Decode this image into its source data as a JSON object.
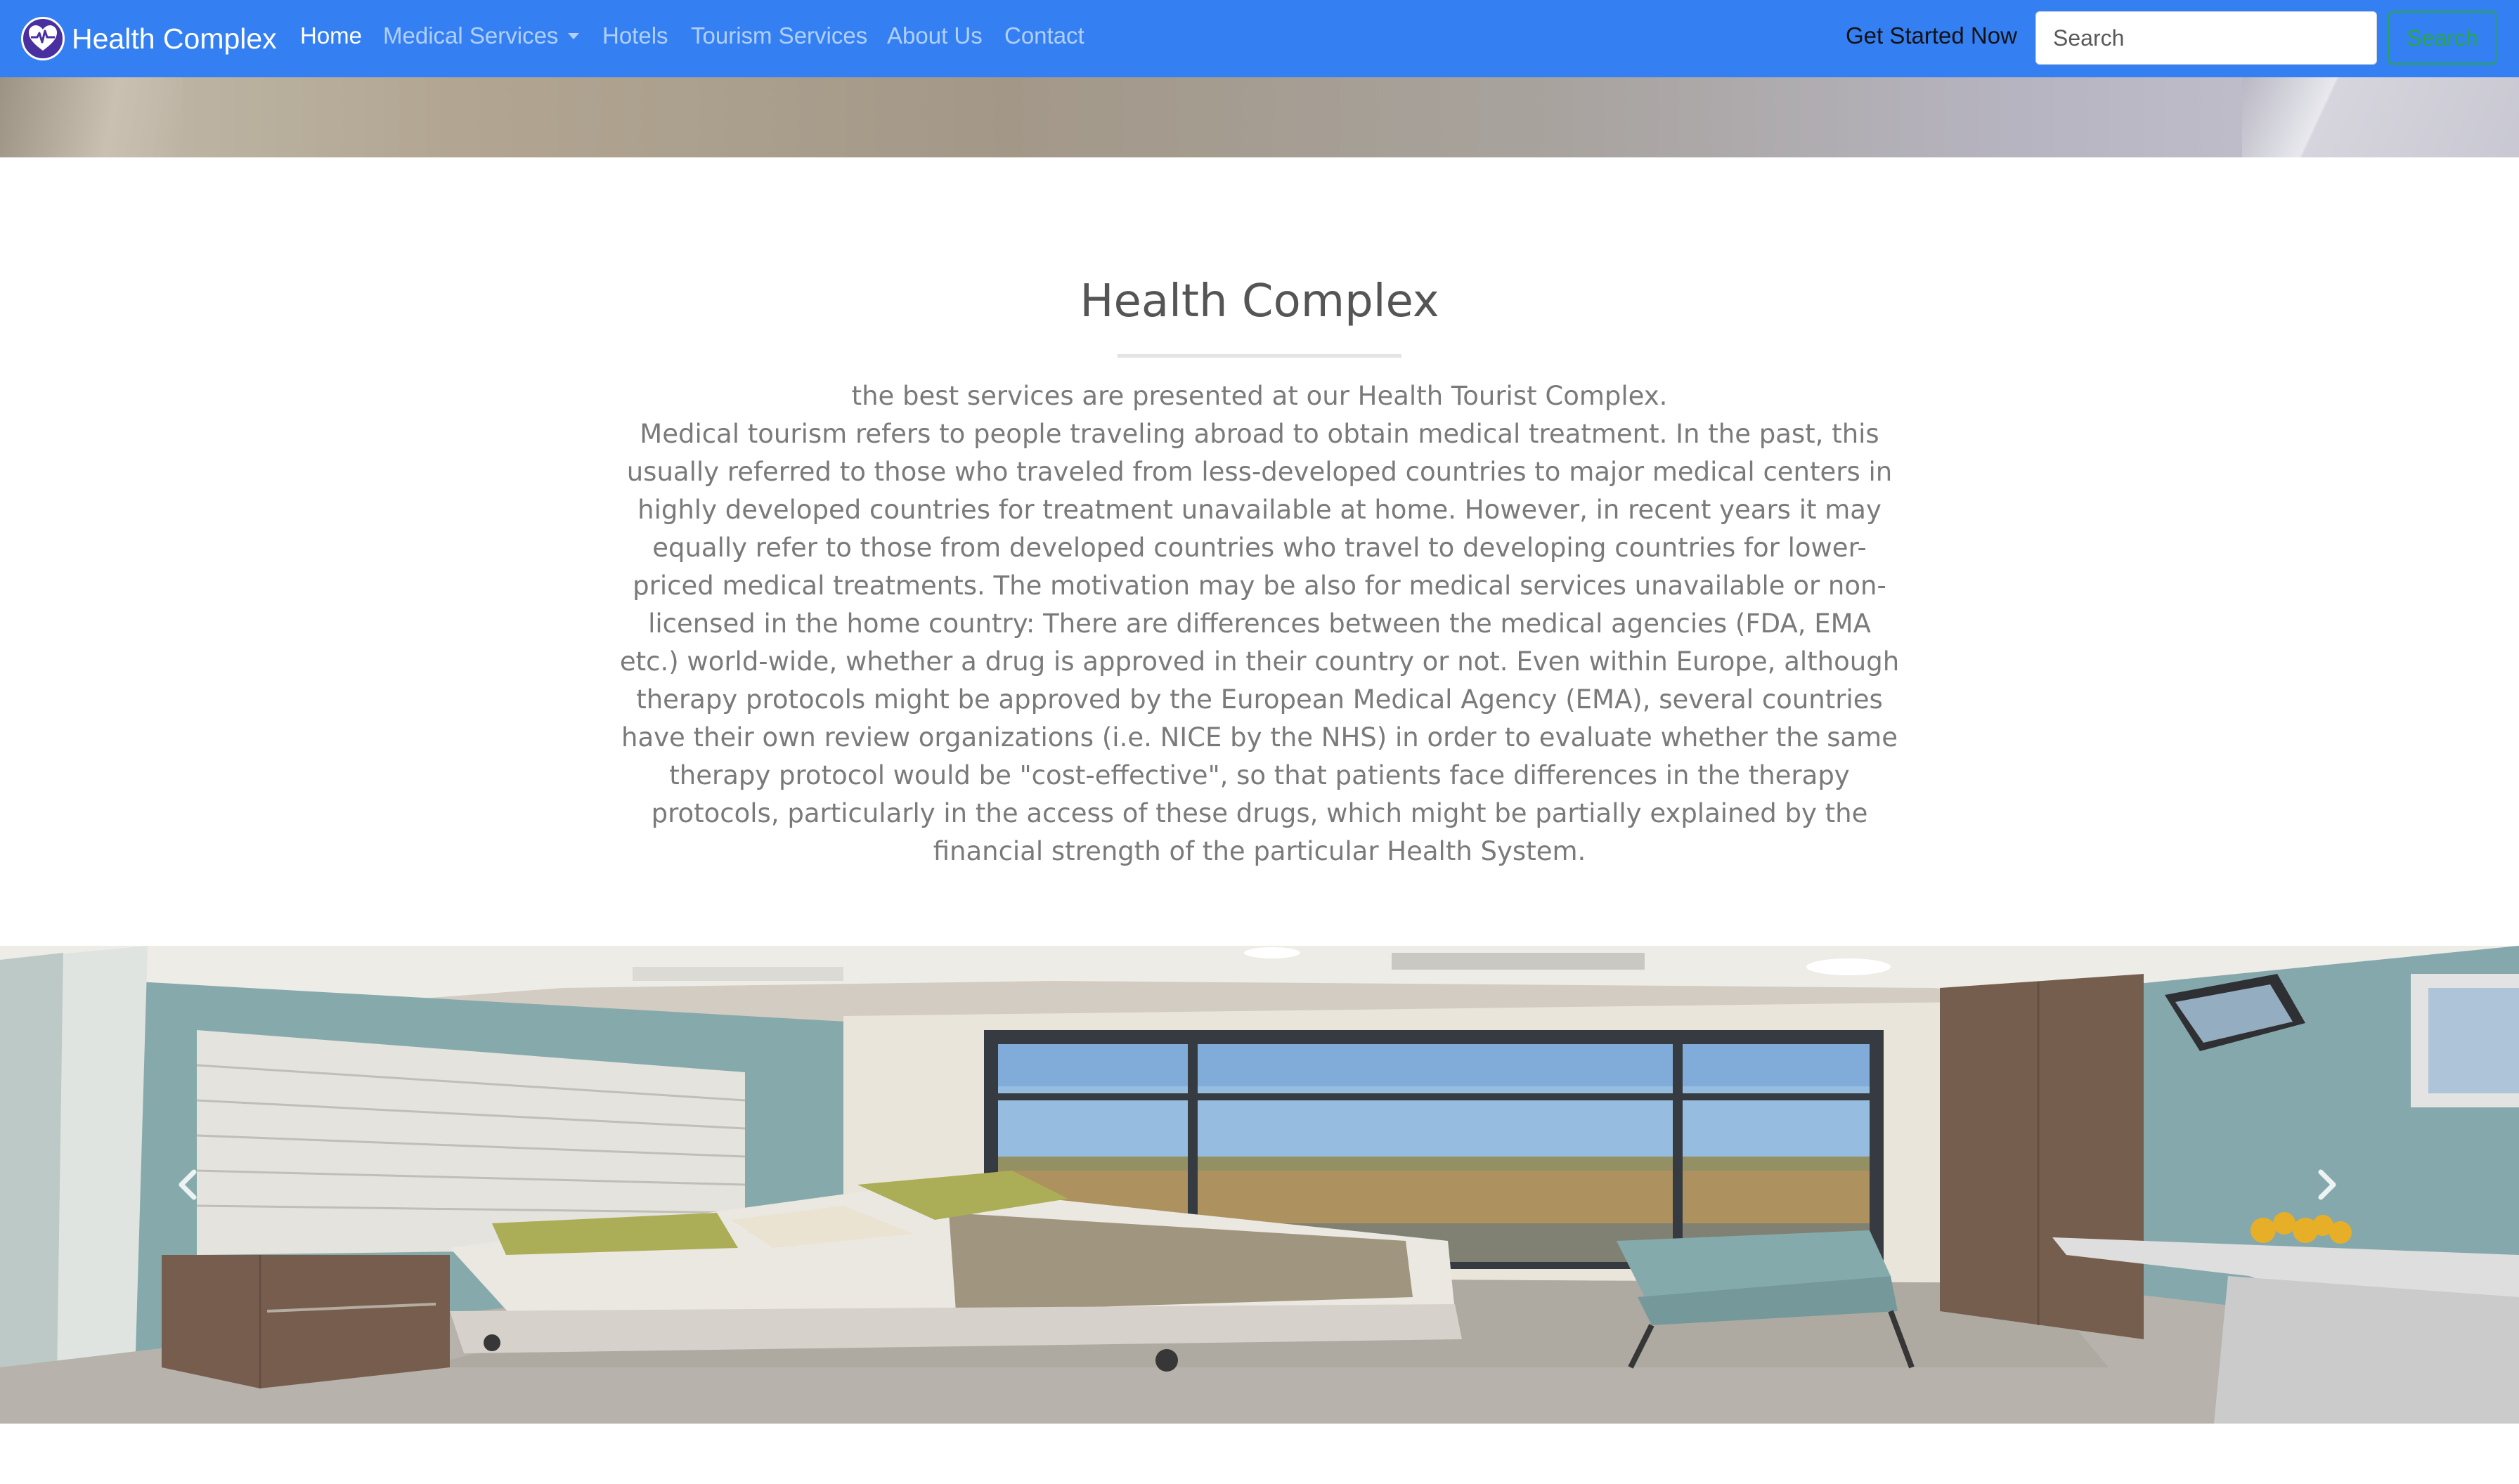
{
  "navbar": {
    "brand": "Health Complex",
    "brand_icon": "heart-pulse-icon",
    "items": [
      {
        "label": "Home",
        "active": true
      },
      {
        "label": "Medical Services",
        "dropdown": true
      },
      {
        "label": "Hotels"
      },
      {
        "label": "Tourism Services"
      },
      {
        "label": "About Us"
      },
      {
        "label": "Contact"
      }
    ],
    "cta": "Get Started Now",
    "search": {
      "placeholder": "Search",
      "button": "Search"
    }
  },
  "main": {
    "title": "Health Complex",
    "intro": "the best services are presented at our Health Tourist Complex.\nMedical tourism refers to people traveling abroad to obtain medical treatment. In the past, this usually referred to those who traveled from less-developed countries to major medical centers in highly developed countries for treatment unavailable at home. However, in recent years it may equally refer to those from developed countries who travel to developing countries for lower-priced medical treatments. The motivation may be also for medical services unavailable or non-licensed in the home country: There are differences between the medical agencies (FDA, EMA etc.) world-wide, whether a drug is approved in their country or not. Even within Europe, although therapy protocols might be approved by the European Medical Agency (EMA), several countries have their own review organizations (i.e. NICE by the NHS) in order to evaluate whether the same therapy protocol would be \"cost-effective\", so that patients face differences in the therapy protocols, particularly in the access of these drugs, which might be partially explained by the financial strength of the particular Health System."
  },
  "carousel": {
    "prev_icon": "chevron-left-icon",
    "next_icon": "chevron-right-icon"
  },
  "colors": {
    "navbar": "#3480f3",
    "search_button": "#28a745",
    "text_muted": "#7a7a7a",
    "title": "#555555"
  }
}
